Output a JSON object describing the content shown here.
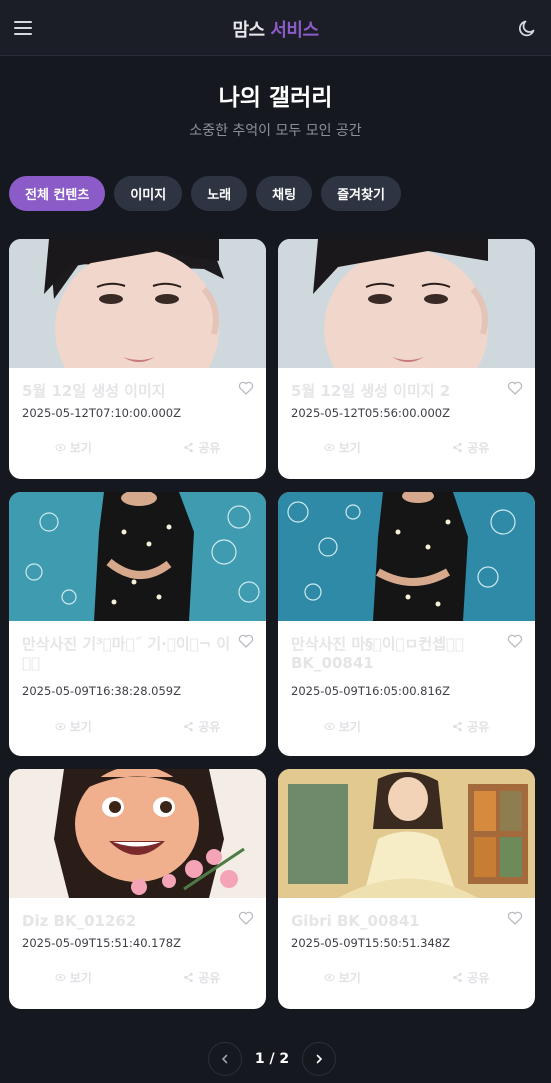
{
  "brand": {
    "part1": "맘스",
    "part2": "서비스"
  },
  "header": {
    "title": "나의 갤러리",
    "subtitle": "소중한 추억이 모두 모인 공간"
  },
  "filters": [
    "전체 컨텐츠",
    "이미지",
    "노래",
    "채팅",
    "즐겨찾기"
  ],
  "active_filter": "전체 컨텐츠",
  "cards": [
    {
      "title": "5월 12일 생성 이미지",
      "date": "2025-05-12T07:10:00.000Z"
    },
    {
      "title": "5월 12일 생성 이미지 2",
      "date": "2025-05-12T05:56:00.000Z"
    },
    {
      "title": "만삭사진 기³􏿾마􏿾˝ 기·􏿾이􏿾¬ 이􏿾􏿾",
      "date": "2025-05-09T16:38:28.059Z"
    },
    {
      "title": "만삭사진 마§􏿾이􏿾ㅁ컨셉􏿾􏿾 BK_00841",
      "date": "2025-05-09T16:05:00.816Z"
    },
    {
      "title": "Diz BK_01262",
      "date": "2025-05-09T15:51:40.178Z"
    },
    {
      "title": "Gibri BK_00841",
      "date": "2025-05-09T15:50:51.348Z"
    }
  ],
  "card_actions": {
    "view": "보기",
    "share": "공유"
  },
  "pagination": {
    "label": "1 / 2"
  },
  "colors": {
    "accent": "#8b5cc8",
    "background": "#161820",
    "chip": "#2f3443"
  }
}
